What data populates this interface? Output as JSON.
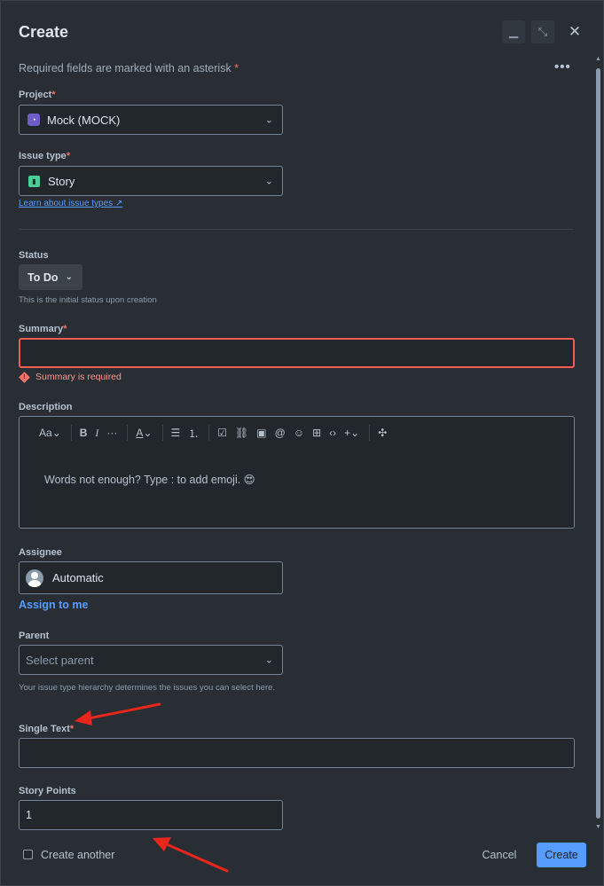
{
  "header": {
    "title": "Create",
    "minimize_icon": "minimize-icon",
    "collapse_icon": "collapse-icon",
    "close_icon": "close-icon"
  },
  "required_note": {
    "text": "Required fields are marked with an asterisk",
    "asterisk": "*"
  },
  "more_icon": "more-horizontal-icon",
  "project": {
    "label": "Project",
    "asterisk": "*",
    "value": "Mock (MOCK)",
    "icon": "project-avatar-icon"
  },
  "issue_type": {
    "label": "Issue type",
    "asterisk": "*",
    "value": "Story",
    "icon": "story-icon",
    "learn_link": "Learn about issue types"
  },
  "status": {
    "label": "Status",
    "value": "To Do",
    "help": "This is the initial status upon creation"
  },
  "summary": {
    "label": "Summary",
    "asterisk": "*",
    "value": "",
    "error": "Summary is required"
  },
  "description": {
    "label": "Description",
    "placeholder": "Words not enough? Type : to add emoji. 😍",
    "toolbar": {
      "text_style": "Aa",
      "bold": "B",
      "italic": "I",
      "more": "···",
      "color": "A"
    }
  },
  "assignee": {
    "label": "Assignee",
    "value": "Automatic",
    "assign_me": "Assign to me"
  },
  "parent": {
    "label": "Parent",
    "placeholder": "Select parent",
    "help": "Your issue type hierarchy determines the issues you can select here."
  },
  "single_text": {
    "label": "Single Text",
    "asterisk": "*",
    "value": ""
  },
  "story_points": {
    "label": "Story Points",
    "value": "1"
  },
  "footer": {
    "create_another": "Create another",
    "cancel": "Cancel",
    "create": "Create"
  },
  "colors": {
    "background": "#282e33",
    "accent": "#579dff",
    "error": "#f87168",
    "annotation_arrow": "#e8261c"
  }
}
